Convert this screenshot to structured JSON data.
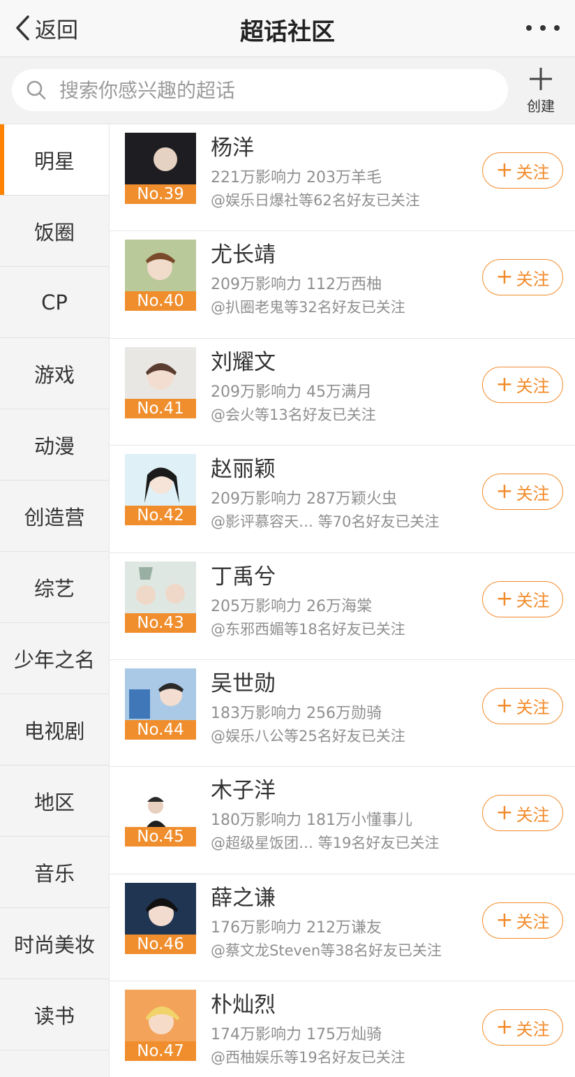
{
  "header": {
    "back_label": "返回",
    "title": "超话社区"
  },
  "search": {
    "placeholder": "搜索你感兴趣的超话",
    "create_label": "创建"
  },
  "sidebar": {
    "items": [
      {
        "label": "明星",
        "active": true
      },
      {
        "label": "饭圈"
      },
      {
        "label": "CP"
      },
      {
        "label": "游戏"
      },
      {
        "label": "动漫"
      },
      {
        "label": "创造营"
      },
      {
        "label": "综艺"
      },
      {
        "label": "少年之名"
      },
      {
        "label": "电视剧"
      },
      {
        "label": "地区"
      },
      {
        "label": "音乐"
      },
      {
        "label": "时尚美妆"
      },
      {
        "label": "读书"
      }
    ]
  },
  "follow_label": "关注",
  "list": [
    {
      "rank": "No.39",
      "name": "杨洋",
      "stats": "221万影响力 203万羊毛",
      "friends": "@娱乐日爆社等62名好友已关注"
    },
    {
      "rank": "No.40",
      "name": "尤长靖",
      "stats": "209万影响力 112万西柚",
      "friends": "@扒圈老鬼等32名好友已关注"
    },
    {
      "rank": "No.41",
      "name": "刘耀文",
      "stats": "209万影响力 45万满月",
      "friends": "@会火等13名好友已关注"
    },
    {
      "rank": "No.42",
      "name": "赵丽颖",
      "stats": "209万影响力 287万颖火虫",
      "friends": "@影评慕容天… 等70名好友已关注"
    },
    {
      "rank": "No.43",
      "name": "丁禹兮",
      "stats": "205万影响力 26万海棠",
      "friends": "@东邪西媚等18名好友已关注"
    },
    {
      "rank": "No.44",
      "name": "吴世勋",
      "stats": "183万影响力 256万勋骑",
      "friends": "@娱乐八公等25名好友已关注"
    },
    {
      "rank": "No.45",
      "name": "木子洋",
      "stats": "180万影响力 181万小懂事儿",
      "friends": "@超级星饭团… 等19名好友已关注"
    },
    {
      "rank": "No.46",
      "name": "薛之谦",
      "stats": "176万影响力 212万谦友",
      "friends": "@蔡文龙Steven等38名好友已关注"
    },
    {
      "rank": "No.47",
      "name": "朴灿烈",
      "stats": "174万影响力 175万灿骑",
      "friends": "@西柚娱乐等19名好友已关注"
    }
  ],
  "colors": {
    "accent": "#ff8200",
    "rank_bg": "#f08e2d",
    "follow": "#f28b2b"
  }
}
